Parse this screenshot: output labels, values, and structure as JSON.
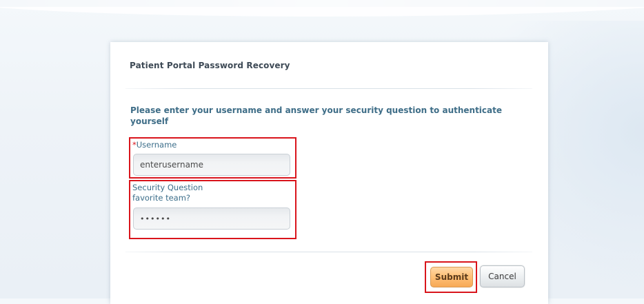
{
  "page": {
    "title": "Patient Portal Password Recovery",
    "instructions": "Please enter your username and answer your security question to authenticate yourself"
  },
  "form": {
    "username": {
      "required_marker": "*",
      "label": "Username",
      "value": "enterusername"
    },
    "security": {
      "label": "Security Question",
      "question": "favorite team?",
      "value": "••••••"
    }
  },
  "buttons": {
    "submit": "Submit",
    "cancel": "Cancel"
  },
  "colors": {
    "highlight": "#d9141b",
    "label": "#3c6e8a",
    "submit_fill": "#ffc27a"
  }
}
